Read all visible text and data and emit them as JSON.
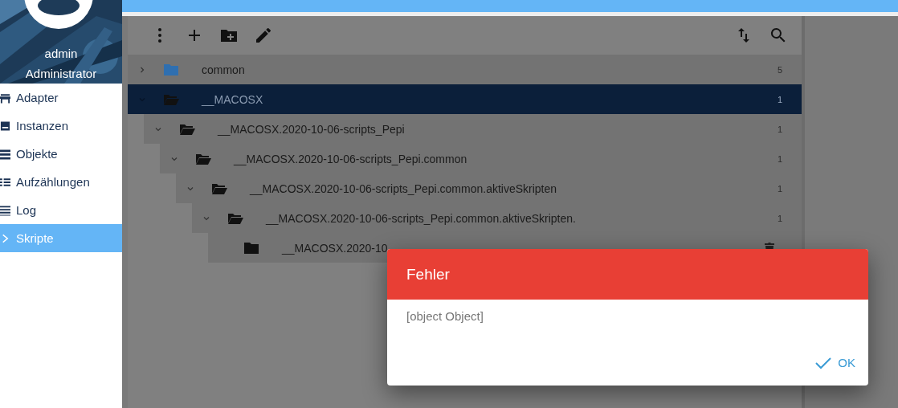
{
  "sidebar": {
    "user": {
      "name": "admin",
      "role": "Administrator"
    },
    "items": [
      {
        "label": "Adapter",
        "selected": false
      },
      {
        "label": "Instanzen",
        "selected": false
      },
      {
        "label": "Objekte",
        "selected": false
      },
      {
        "label": "Aufzählungen",
        "selected": false
      },
      {
        "label": "Log",
        "selected": false
      },
      {
        "label": "Skripte",
        "selected": true
      }
    ]
  },
  "tree": {
    "rows": [
      {
        "name": "common",
        "count": "5",
        "color": "#2f6fb0",
        "expanded": false,
        "selected": false
      },
      {
        "name": "__MACOSX",
        "count": "1",
        "color": "#111111",
        "expanded": true,
        "selected": true,
        "children": [
          {
            "name": "__MACOSX.2020-10-06-scripts_Pepi",
            "count": "1",
            "color": "#111111",
            "expanded": true,
            "selected": false,
            "children": [
              {
                "name": "__MACOSX.2020-10-06-scripts_Pepi.common",
                "count": "1",
                "color": "#111111",
                "expanded": true,
                "selected": false,
                "children": [
                  {
                    "name": "__MACOSX.2020-10-06-scripts_Pepi.common.aktiveSkripten",
                    "count": "1",
                    "color": "#111111",
                    "expanded": true,
                    "selected": false,
                    "children": [
                      {
                        "name": "__MACOSX.2020-10-06-scripts_Pepi.common.aktiveSkripten.",
                        "count": "1",
                        "color": "#111111",
                        "expanded": true,
                        "selected": false,
                        "children": [
                          {
                            "name": "__MACOSX.2020-10",
                            "color": "#111111",
                            "selected": false,
                            "deletable": true
                          }
                        ]
                      }
                    ]
                  }
                ]
              }
            ]
          }
        ]
      }
    ]
  },
  "dialog": {
    "title": "Fehler",
    "message": "[object Object]",
    "button": "OK"
  }
}
